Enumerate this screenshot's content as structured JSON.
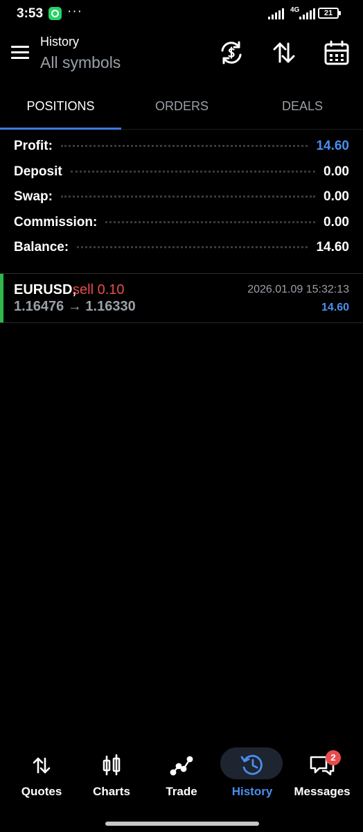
{
  "status_bar": {
    "time": "3:53",
    "more": "···",
    "network": "4G",
    "battery": "21"
  },
  "header": {
    "title": "History",
    "subtitle": "All symbols"
  },
  "tabs": [
    {
      "label": "POSITIONS",
      "active": true
    },
    {
      "label": "ORDERS",
      "active": false
    },
    {
      "label": "DEALS",
      "active": false
    }
  ],
  "summary": [
    {
      "label": "Profit:",
      "value": "14.60"
    },
    {
      "label": "Deposit",
      "value": "0.00"
    },
    {
      "label": "Swap:",
      "value": "0.00"
    },
    {
      "label": "Commission:",
      "value": "0.00"
    },
    {
      "label": "Balance:",
      "value": "14.60"
    }
  ],
  "positions": [
    {
      "symbol": "EURUSD,",
      "side": "sell 0.10",
      "prices": "1.16476 → 1.16330",
      "timestamp": "2026.01.09 15:32:13",
      "profit": "14.60"
    }
  ],
  "nav": [
    {
      "label": "Quotes",
      "icon": "quotes-arrows-icon"
    },
    {
      "label": "Charts",
      "icon": "candlestick-icon"
    },
    {
      "label": "Trade",
      "icon": "trade-line-icon"
    },
    {
      "label": "History",
      "icon": "history-clock-icon",
      "active": true
    },
    {
      "label": "Messages",
      "icon": "messages-icon",
      "badge": "2"
    }
  ],
  "colors": {
    "accent": "#3b7be0",
    "profit_blue": "#4a8ef0",
    "sell_red": "#e84d4d",
    "buy_green": "#2eb84c",
    "muted": "#9aa0a8"
  }
}
